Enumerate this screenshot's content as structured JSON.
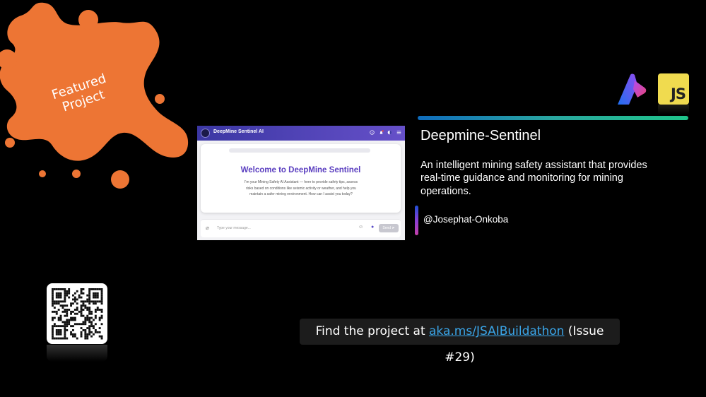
{
  "badge": {
    "label_line1": "Featured",
    "label_line2": "Project",
    "color": "#ed7534"
  },
  "logos": {
    "azure_icon": "azure-logo-icon",
    "js_label": "JS"
  },
  "project": {
    "title": "Deepmine-Sentinel",
    "description": "An intelligent mining safety assistant that provides real-time guidance and monitoring for mining operations.",
    "author": "@Josephat-Onkoba"
  },
  "screenshot": {
    "app_title": "DeepMine Sentinel AI",
    "welcome": "Welcome to DeepMine Sentinel",
    "intro": "I'm your Mining Safety AI Assistant — here to provide safety tips, assess risks based on conditions like seismic activity or weather, and help you maintain a safer mining environment. How can I assist you today?",
    "input_placeholder": "Type your message...",
    "send_label": "Send"
  },
  "footer": {
    "prefix": "Find the project at ",
    "link_text": "aka.ms/JSAIBuildathon",
    "suffix": " (Issue #29)"
  }
}
